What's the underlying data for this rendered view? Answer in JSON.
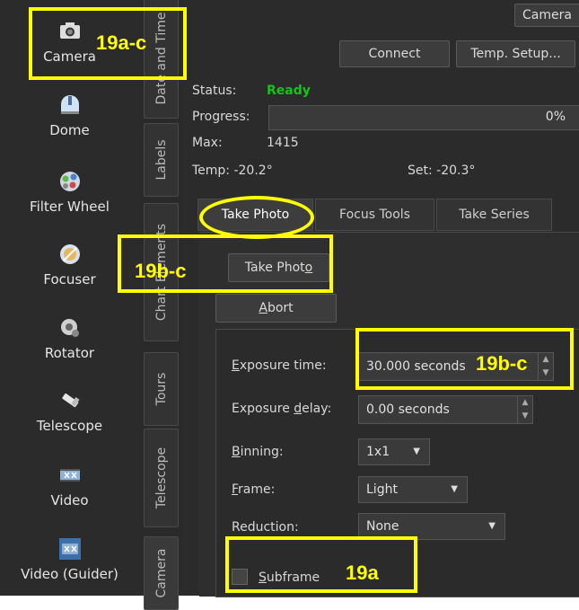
{
  "devices": [
    {
      "label": "Camera",
      "icon": "camera-icon"
    },
    {
      "label": "Dome",
      "icon": "dome-icon"
    },
    {
      "label": "Filter Wheel",
      "icon": "filter-wheel-icon"
    },
    {
      "label": "Focuser",
      "icon": "focuser-icon"
    },
    {
      "label": "Rotator",
      "icon": "rotator-icon"
    },
    {
      "label": "Telescope",
      "icon": "telescope-icon"
    },
    {
      "label": "Video",
      "icon": "video-icon"
    },
    {
      "label": "Video (Guider)",
      "icon": "video-guider-icon"
    }
  ],
  "vtabs": [
    "Date and Time",
    "Labels",
    "Chart Elements",
    "Tours",
    "Telescope",
    "Camera"
  ],
  "header": {
    "top_tab": "Camera",
    "connect_label": "Connect",
    "temp_setup_label": "Temp. Setup..."
  },
  "status": {
    "status_label": "Status:",
    "status_value": "Ready",
    "progress_label": "Progress:",
    "progress_value": "0%",
    "max_label": "Max:",
    "max_value": "1415",
    "temp_label": "Temp: -20.2°",
    "set_label": "Set: -20.3°"
  },
  "tabs": [
    "Take Photo",
    "Focus Tools",
    "Take Series"
  ],
  "actions": {
    "take_photo_pre": "Take Phot",
    "take_photo_ul": "o",
    "abort_ul": "A",
    "abort_rest": "bort"
  },
  "form": {
    "exposure_time_ul": "E",
    "exposure_time_rest": "xposure time:",
    "exposure_time_value": "30.000 seconds",
    "exposure_delay_pre": "Exposure ",
    "exposure_delay_ul": "d",
    "exposure_delay_rest": "elay:",
    "exposure_delay_value": "0.00 seconds",
    "binning_ul": "B",
    "binning_rest": "inning:",
    "binning_value": "1x1",
    "frame_ul": "F",
    "frame_rest": "rame:",
    "frame_value": "Light",
    "reduction_label": "Reduction:",
    "reduction_value": "None",
    "subframe_ul": "S",
    "subframe_rest": "ubframe"
  },
  "annotations": {
    "a1": "19a-c",
    "a2": "19b-c",
    "a3": "19b-c",
    "a4": "19a"
  },
  "colors": {
    "annotation": "#ffff00",
    "ready": "#19c219",
    "background": "#2b2b2b"
  }
}
